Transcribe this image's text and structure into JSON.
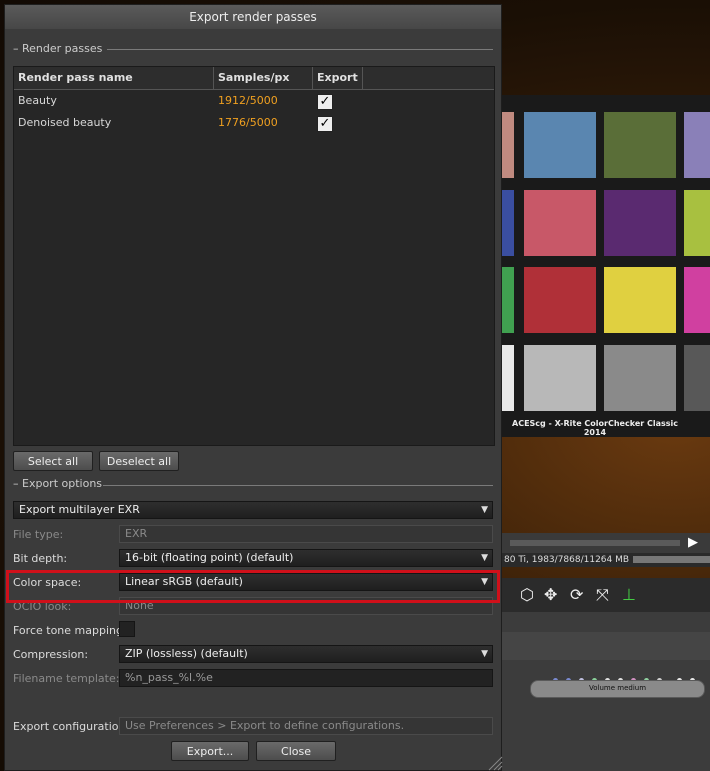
{
  "dialog": {
    "title": "Export render passes",
    "render_passes_group": "– Render passes",
    "table": {
      "headers": [
        "Render pass name",
        "Samples/px",
        "Export"
      ],
      "rows": [
        {
          "name": "Beauty",
          "samples": "1912/5000",
          "export": true
        },
        {
          "name": "Denoised beauty",
          "samples": "1776/5000",
          "export": true
        }
      ]
    },
    "select_all": "Select all",
    "deselect_all": "Deselect all",
    "export_options_group": "– Export options",
    "export_mode": "Export multilayer EXR",
    "fields": {
      "file_type": {
        "label": "File type:",
        "value": "EXR"
      },
      "bit_depth": {
        "label": "Bit depth:",
        "value": "16-bit (floating point) (default)"
      },
      "color_space": {
        "label": "Color space:",
        "value": "Linear sRGB (default)"
      },
      "ocio_look": {
        "label": "OCIO look:",
        "value": "None"
      },
      "force_tone_mapping": {
        "label": "Force tone mapping:"
      },
      "compression": {
        "label": "Compression:",
        "value": "ZIP (lossless) (default)"
      },
      "filename_template": {
        "label": "Filename template:",
        "value": "%n_pass_%l.%e"
      },
      "export_configuration": {
        "label": "Export configuration:",
        "placeholder": "Use Preferences > Export to define configurations."
      }
    },
    "export_button": "Export...",
    "close_button": "Close"
  },
  "background": {
    "viewport_caption": "ACEScg - X-Rite ColorChecker Classic 2014",
    "status": "80 Ti, 1983/7868/11264 MB",
    "node_label": "Volume medium"
  },
  "colors": {
    "accent_samples": "#f0a020",
    "highlight": "#d0101a"
  }
}
